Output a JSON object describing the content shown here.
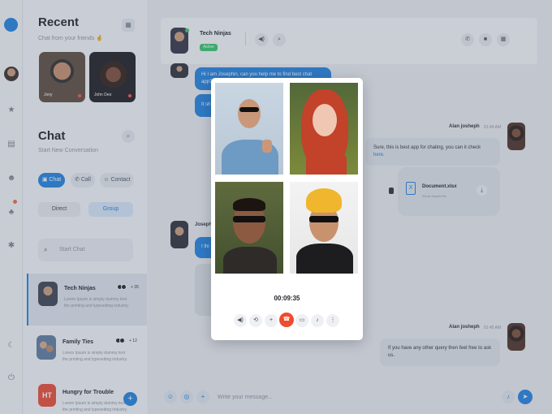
{
  "sidebar": {
    "recent_title": "Recent",
    "recent_subtitle": "Chat from your friends 🤞",
    "stories": [
      {
        "name": "Jony"
      },
      {
        "name": "John Deo"
      }
    ],
    "chat_title": "Chat",
    "chat_subtitle": "Start New Conversation",
    "filters": [
      "Chat",
      "Call",
      "Contact"
    ],
    "segments": [
      "Direct",
      "Group"
    ],
    "search_placeholder": "Start Chat",
    "conversations": [
      {
        "name": "Tech Ninjas",
        "preview": "Lorem Ipsum is simply dummy text the printing and typesetting industry.",
        "count": "+ 35"
      },
      {
        "name": "Family Ties",
        "preview": "Lorem Ipsum is simply dummy text the printing and typesetting industry.",
        "count": "+ 12"
      },
      {
        "name": "Hungry for Trouble",
        "initials": "HT",
        "preview": "Lorem Ipsum is simply dummy text the printing and typesetting industry."
      }
    ]
  },
  "chat": {
    "title": "Tech Ninjas",
    "status": "Active",
    "messages": [
      {
        "text": "Hi I am Josephin, can you help me to find best chat app?."
      },
      {
        "text": "It sh"
      },
      {
        "sender": "Alan josheph",
        "time": "01:40 AM",
        "text": "Sure, this is best app for chating, you can it check ",
        "link": "here."
      },
      {
        "sender": "Joseph"
      },
      {
        "text": "I thi"
      },
      {
        "sender": "Alan josheph",
        "time": "01:45 AM",
        "text": "If you have any other query then feel free to ask us."
      }
    ],
    "file": {
      "name": "Document.xlsx",
      "size": "25mb Sepate file"
    },
    "composer_placeholder": "Write your message..."
  },
  "call": {
    "timer": "00:09:35"
  },
  "colors": {
    "accent": "#1f80e0",
    "active": "#35c46a",
    "end_call": "#ef4b2e"
  }
}
